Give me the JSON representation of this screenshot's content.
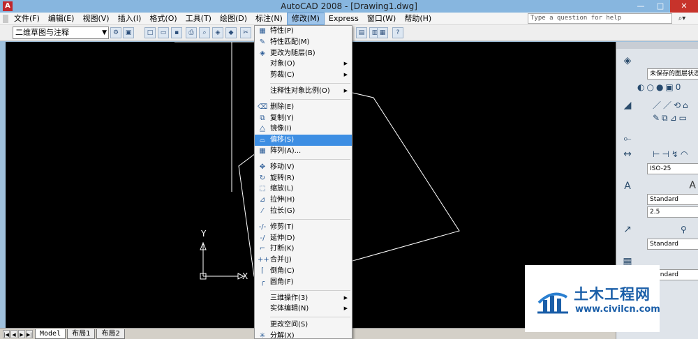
{
  "window": {
    "title": "AutoCAD 2008 - [Drawing1.dwg]",
    "minimize": "—",
    "maximize": "□",
    "close": "✕"
  },
  "menubar": {
    "items": [
      "文件(F)",
      "编辑(E)",
      "视图(V)",
      "插入(I)",
      "格式(O)",
      "工具(T)",
      "绘图(D)",
      "标注(N)",
      "修改(M)",
      "Express",
      "窗口(W)",
      "帮助(H)"
    ],
    "active_index": 8,
    "help_placeholder": "Type a question for help"
  },
  "toolbar": {
    "workspace": "二维草图与注释"
  },
  "modify_menu": {
    "groups": [
      [
        {
          "label": "特性(P)",
          "icon": "properties-icon",
          "glyph": "▦"
        },
        {
          "label": "特性匹配(M)",
          "icon": "match-properties-icon",
          "glyph": "✎"
        },
        {
          "label": "更改为随层(B)",
          "icon": "bylayer-icon",
          "glyph": "◈"
        },
        {
          "label": "对象(O)",
          "submenu": true
        },
        {
          "label": "剪裁(C)",
          "submenu": true
        }
      ],
      [
        {
          "label": "注释性对象比例(O)",
          "submenu": true
        }
      ],
      [
        {
          "label": "删除(E)",
          "icon": "erase-icon",
          "glyph": "⌫"
        },
        {
          "label": "复制(Y)",
          "icon": "copy-icon",
          "glyph": "⧉"
        },
        {
          "label": "镜像(I)",
          "icon": "mirror-icon",
          "glyph": "⧋"
        },
        {
          "label": "偏移(S)",
          "icon": "offset-icon",
          "glyph": "⌓",
          "highlighted": true
        },
        {
          "label": "阵列(A)...",
          "icon": "array-icon",
          "glyph": "▦"
        }
      ],
      [
        {
          "label": "移动(V)",
          "icon": "move-icon",
          "glyph": "✥"
        },
        {
          "label": "旋转(R)",
          "icon": "rotate-icon",
          "glyph": "↻"
        },
        {
          "label": "缩放(L)",
          "icon": "scale-icon",
          "glyph": "⬚"
        },
        {
          "label": "拉伸(H)",
          "icon": "stretch-icon",
          "glyph": "⊿"
        },
        {
          "label": "拉长(G)",
          "icon": "lengthen-icon",
          "glyph": "⁄"
        }
      ],
      [
        {
          "label": "修剪(T)",
          "icon": "trim-icon",
          "glyph": "-/-"
        },
        {
          "label": "延伸(D)",
          "icon": "extend-icon",
          "glyph": "-/"
        },
        {
          "label": "打断(K)",
          "icon": "break-icon",
          "glyph": "⌐"
        },
        {
          "label": "合并(J)",
          "icon": "join-icon",
          "glyph": "++"
        },
        {
          "label": "倒角(C)",
          "icon": "chamfer-icon",
          "glyph": "⌈"
        },
        {
          "label": "圆角(F)",
          "icon": "fillet-icon",
          "glyph": "╭"
        }
      ],
      [
        {
          "label": "三维操作(3)",
          "submenu": true
        },
        {
          "label": "实体编辑(N)",
          "submenu": true
        }
      ],
      [
        {
          "label": "更改空间(S)",
          "icon": "change-space-icon",
          "glyph": ""
        },
        {
          "label": "分解(X)",
          "icon": "explode-icon",
          "glyph": "✳"
        }
      ]
    ]
  },
  "ucs": {
    "x_label": "X",
    "y_label": "Y"
  },
  "layout_tabs": [
    "Model",
    "布局1",
    "布局2"
  ],
  "palette": {
    "layer_state": "未保存的图层状态",
    "dim_style": "ISO-25",
    "text_style": "Standard",
    "text_height": "2.5",
    "table_style": "Standard",
    "mleader_style": "Standard",
    "text_icon_label": "A"
  },
  "watermark": {
    "name": "土木工程网",
    "url": "www.civilcn.com"
  }
}
